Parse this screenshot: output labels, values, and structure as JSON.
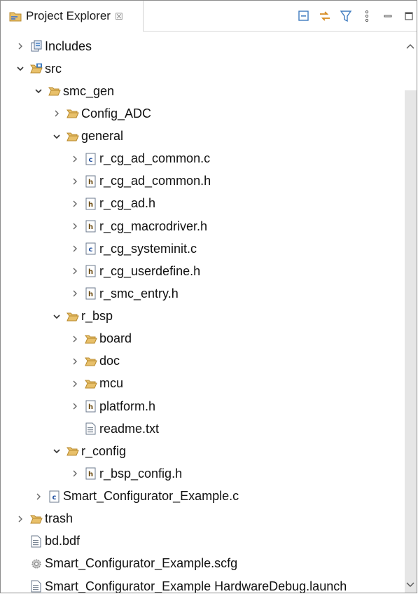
{
  "panel": {
    "title": "Project Explorer",
    "close_glyph": "☒",
    "toolbar": [
      "collapse-all-icon",
      "link-with-editor-icon",
      "filter-icon",
      "view-menu-icon",
      "minimize-icon",
      "maximize-icon"
    ]
  },
  "colors": {
    "folder_fill": "#e8c06a",
    "folder_stroke": "#b88a2e",
    "file_h_accent": "#6b4a10",
    "file_c_accent": "#1f4fa0",
    "selection_none": "#ffffff"
  },
  "tree": [
    {
      "label": "Includes",
      "depth": 1,
      "twisty": "collapsed",
      "icon": "includes-icon"
    },
    {
      "label": "src",
      "depth": 1,
      "twisty": "expanded",
      "icon": "source-folder-icon"
    },
    {
      "label": "smc_gen",
      "depth": 2,
      "twisty": "expanded",
      "icon": "folder-open-icon"
    },
    {
      "label": "Config_ADC",
      "depth": 3,
      "twisty": "collapsed",
      "icon": "folder-open-icon"
    },
    {
      "label": "general",
      "depth": 3,
      "twisty": "expanded",
      "icon": "folder-open-icon"
    },
    {
      "label": "r_cg_ad_common.c",
      "depth": 4,
      "twisty": "collapsed",
      "icon": "c-file-icon"
    },
    {
      "label": "r_cg_ad_common.h",
      "depth": 4,
      "twisty": "collapsed",
      "icon": "h-file-icon"
    },
    {
      "label": "r_cg_ad.h",
      "depth": 4,
      "twisty": "collapsed",
      "icon": "h-file-icon"
    },
    {
      "label": "r_cg_macrodriver.h",
      "depth": 4,
      "twisty": "collapsed",
      "icon": "h-file-icon"
    },
    {
      "label": "r_cg_systeminit.c",
      "depth": 4,
      "twisty": "collapsed",
      "icon": "c-file-icon"
    },
    {
      "label": "r_cg_userdefine.h",
      "depth": 4,
      "twisty": "collapsed",
      "icon": "h-file-icon"
    },
    {
      "label": "r_smc_entry.h",
      "depth": 4,
      "twisty": "collapsed",
      "icon": "h-file-icon"
    },
    {
      "label": "r_bsp",
      "depth": 3,
      "twisty": "expanded",
      "icon": "folder-open-icon"
    },
    {
      "label": "board",
      "depth": 4,
      "twisty": "collapsed",
      "icon": "folder-open-icon"
    },
    {
      "label": "doc",
      "depth": 4,
      "twisty": "collapsed",
      "icon": "folder-open-icon"
    },
    {
      "label": "mcu",
      "depth": 4,
      "twisty": "collapsed",
      "icon": "folder-open-icon"
    },
    {
      "label": "platform.h",
      "depth": 4,
      "twisty": "collapsed",
      "icon": "h-file-icon"
    },
    {
      "label": "readme.txt",
      "depth": 4,
      "twisty": "none",
      "icon": "text-file-icon"
    },
    {
      "label": "r_config",
      "depth": 3,
      "twisty": "expanded",
      "icon": "folder-open-icon"
    },
    {
      "label": "r_bsp_config.h",
      "depth": 4,
      "twisty": "collapsed",
      "icon": "h-file-icon"
    },
    {
      "label": "Smart_Configurator_Example.c",
      "depth": 2,
      "twisty": "collapsed",
      "icon": "c-file-icon"
    },
    {
      "label": "trash",
      "depth": 1,
      "twisty": "collapsed",
      "icon": "folder-open-icon"
    },
    {
      "label": "bd.bdf",
      "depth": 1,
      "twisty": "none",
      "icon": "text-file-icon"
    },
    {
      "label": "Smart_Configurator_Example.scfg",
      "depth": 1,
      "twisty": "none",
      "icon": "gear-file-icon"
    },
    {
      "label": "Smart_Configurator_Example HardwareDebug.launch",
      "depth": 1,
      "twisty": "none",
      "icon": "text-file-icon"
    }
  ]
}
